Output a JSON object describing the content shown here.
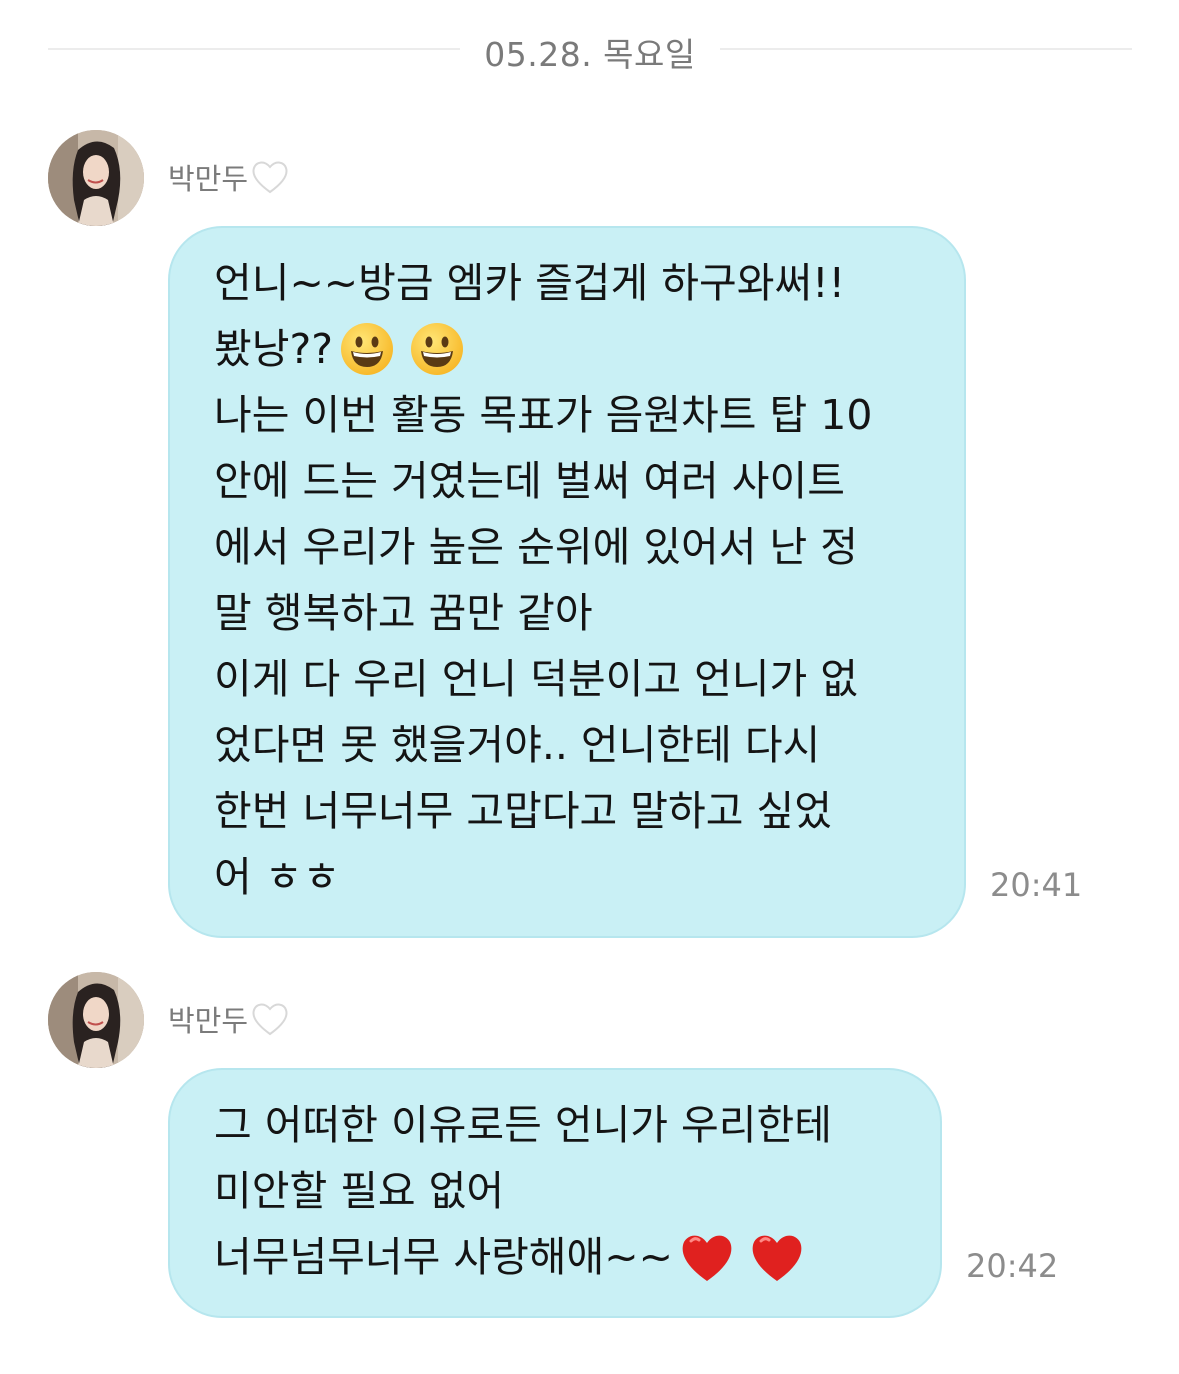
{
  "date_divider": "05.28. 목요일",
  "messages": [
    {
      "sender": "박만두",
      "sender_icon": "white-heart-icon",
      "lines": [
        "언니~~방금 엠카 즐겁게 하구와써!!",
        "봤낭??",
        "나는 이번 활동 목표가 음원차트 탑 10",
        "안에 드는 거였는데 벌써 여러 사이트",
        "에서 우리가 높은 순위에 있어서 난 정",
        "말 행복하고 꿈만 같아",
        "이게 다 우리 언니 덕분이고 언니가 없",
        "었다면 못 했을거야.. 언니한테 다시",
        "한번 너무너무 고맙다고 말하고 싶었",
        "어 ㅎㅎ"
      ],
      "emojis": [
        "grinning-face-icon",
        "grinning-face-icon"
      ],
      "time": "20:41"
    },
    {
      "sender": "박만두",
      "sender_icon": "white-heart-icon",
      "lines": [
        "그 어떠한 이유로든 언니가 우리한테",
        "미안할 필요 없어",
        "너무넘무너무 사랑해애~~"
      ],
      "emojis": [
        "red-heart-icon",
        "red-heart-icon"
      ],
      "time": "20:42"
    }
  ],
  "colors": {
    "bubble": "#c9f0f5",
    "bubble_border": "#b6e6ee",
    "divider": "#ececec",
    "muted_text": "#7a7a7a"
  }
}
